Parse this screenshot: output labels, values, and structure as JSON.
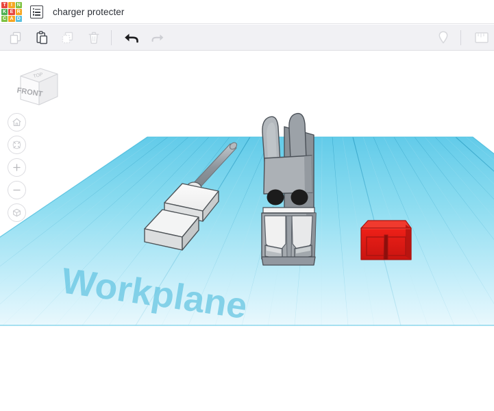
{
  "header": {
    "logo": {
      "name": "tinkercad-logo",
      "tiles": [
        {
          "letter": "T",
          "color": "#e8453c"
        },
        {
          "letter": "I",
          "color": "#f5a623"
        },
        {
          "letter": "N",
          "color": "#7ec242"
        },
        {
          "letter": "K",
          "color": "#4caf50"
        },
        {
          "letter": "E",
          "color": "#e8453c"
        },
        {
          "letter": "R",
          "color": "#f5a623"
        },
        {
          "letter": "C",
          "color": "#7ec242"
        },
        {
          "letter": "A",
          "color": "#f5a623"
        },
        {
          "letter": "D",
          "color": "#5bc0de"
        }
      ]
    },
    "doc_icon_name": "document-list-icon",
    "title": "charger protecter"
  },
  "toolbar": {
    "buttons": [
      {
        "name": "copy-button",
        "label": "Copy",
        "icon": "copy-icon",
        "enabled": false
      },
      {
        "name": "paste-button",
        "label": "Paste",
        "icon": "paste-icon",
        "enabled": true
      },
      {
        "name": "duplicate-button",
        "label": "Duplicate",
        "icon": "duplicate-icon",
        "enabled": false
      },
      {
        "name": "delete-button",
        "label": "Delete",
        "icon": "trash-icon",
        "enabled": false
      },
      {
        "name": "undo-button",
        "label": "Undo",
        "icon": "undo-arrow-icon",
        "enabled": true
      },
      {
        "name": "redo-button",
        "label": "Redo",
        "icon": "redo-arrow-icon",
        "enabled": false
      }
    ],
    "right_buttons": [
      {
        "name": "workplane-button",
        "label": "Workplane",
        "icon": "location-pin-icon",
        "enabled": true
      },
      {
        "name": "ruler-button",
        "label": "Ruler",
        "icon": "ruler-icon",
        "enabled": true
      }
    ]
  },
  "viewport": {
    "view_cube": {
      "name": "view-cube",
      "front_face_label": "FRONT",
      "top_face_label": "TOP"
    },
    "nav_buttons": [
      {
        "name": "home-view-button",
        "label": "Home view",
        "icon": "home-icon"
      },
      {
        "name": "fit-to-view-button",
        "label": "Fit all in view",
        "icon": "fit-arrows-icon"
      },
      {
        "name": "zoom-in-button",
        "label": "Zoom in",
        "icon": "plus-icon"
      },
      {
        "name": "zoom-out-button",
        "label": "Zoom out",
        "icon": "minus-icon"
      },
      {
        "name": "perspective-toggle-button",
        "label": "Switch to orthographic view",
        "icon": "cube-icon"
      }
    ],
    "workplane": {
      "name": "workplane-grid",
      "label": "Workplane",
      "grid_color": "#5ec9e8",
      "fill_color": "#7fd6ef"
    },
    "objects": [
      {
        "name": "charger-plug-shape",
        "label": "Charger plug",
        "color": "#f2f2f2",
        "cable_color": "#9aa0a6"
      },
      {
        "name": "dog-figure-shape",
        "label": "Dog figure",
        "body_color": "#a8adb3",
        "muzzle_color": "#f0f0f0",
        "eye_color": "#1c1c1c"
      },
      {
        "name": "red-protector-box-shape",
        "label": "Charger protector box",
        "color": "#e81b16"
      }
    ]
  }
}
